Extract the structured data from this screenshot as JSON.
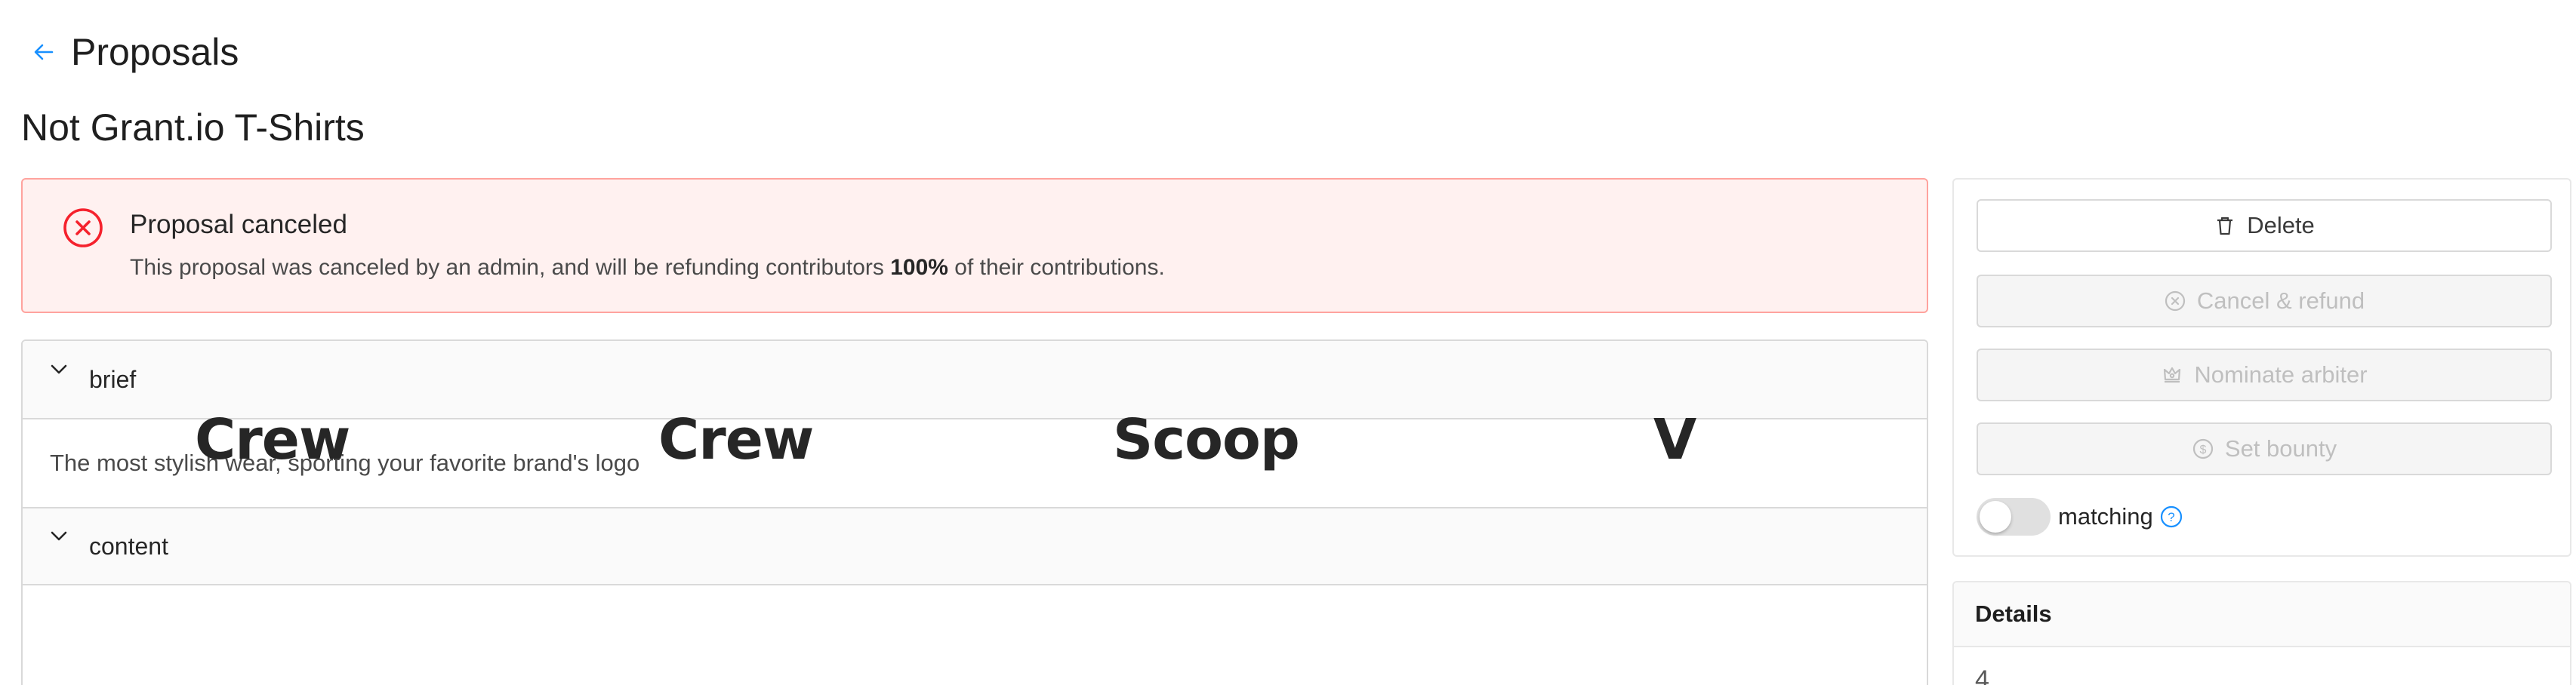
{
  "header": {
    "title": "Proposals"
  },
  "proposal": {
    "title": "Not Grant.io T-Shirts"
  },
  "alert": {
    "title": "Proposal canceled",
    "desc_prefix": "This proposal was canceled by an admin, and will be refunding contributors ",
    "desc_bold": "100%",
    "desc_suffix": " of their contributions."
  },
  "panels": {
    "brief": {
      "label": "brief",
      "text": "The most stylish wear, sporting your favorite brand's logo"
    },
    "content": {
      "label": "content",
      "words": [
        "Crew",
        "Crew",
        "Scoop",
        "V"
      ]
    }
  },
  "sidebar": {
    "delete_label": "Delete",
    "cancel_label": "Cancel & refund",
    "arbiter_label": "Nominate arbiter",
    "bounty_label": "Set bounty",
    "matching_label": "matching",
    "matching_on": false
  },
  "details": {
    "title": "Details",
    "value": "4"
  },
  "icons": {
    "back": "arrow-left-icon",
    "alert": "close-circle-icon",
    "chevron": "chevron-down-icon",
    "delete": "trash-icon",
    "cancel": "close-circle-icon",
    "arbiter": "crown-icon",
    "bounty": "dollar-circle-icon",
    "help": "question-circle-icon"
  },
  "colors": {
    "accent": "#1890ff",
    "error": "#f5222d",
    "error_bg": "#fff1f0",
    "error_border": "#ffa39e"
  }
}
